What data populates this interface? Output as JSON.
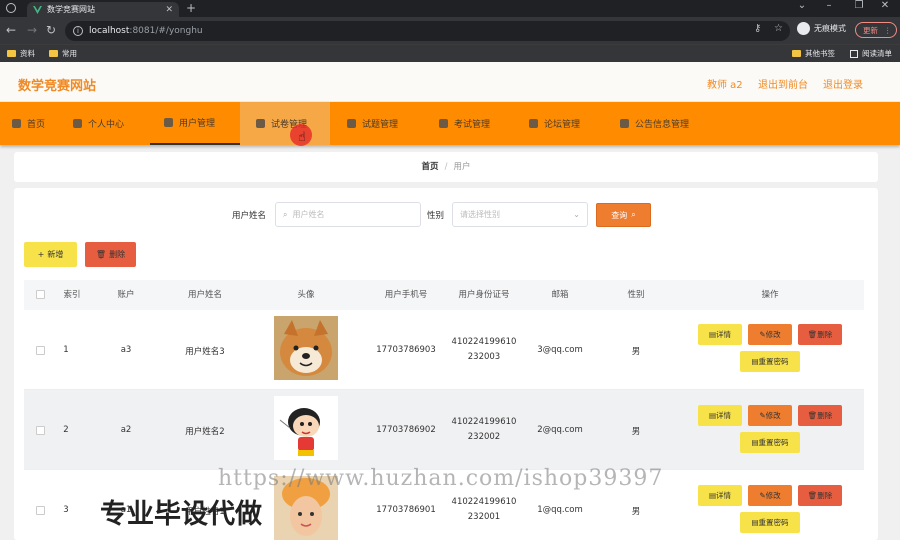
{
  "browser": {
    "tab_title": "数学竞赛网站",
    "url_host": "localhost",
    "url_path": ":8081/#/yonghu",
    "guest_label": "无痕模式",
    "update_label": "更新",
    "bookmarks": [
      "资料",
      "常用"
    ],
    "bookmarks_right": [
      "其他书签",
      "阅读清单"
    ]
  },
  "header": {
    "site_title": "数学竞赛网站",
    "user_label": "教师 a2",
    "backend_link": "退出到前台",
    "logout_link": "退出登录"
  },
  "nav": [
    {
      "label": "首页"
    },
    {
      "label": "个人中心"
    },
    {
      "label": "用户管理"
    },
    {
      "label": "试卷管理"
    },
    {
      "label": "试题管理"
    },
    {
      "label": "考试管理"
    },
    {
      "label": "论坛管理"
    },
    {
      "label": "公告信息管理"
    }
  ],
  "breadcrumb": {
    "home": "首页",
    "current": "用户"
  },
  "search": {
    "name_label": "用户姓名",
    "name_placeholder": "用户姓名",
    "gender_label": "性别",
    "gender_placeholder": "请选择性别",
    "query_button": "查询"
  },
  "actions": {
    "add": "新增",
    "delete": "删除"
  },
  "table": {
    "headers": [
      "索引",
      "账户",
      "用户姓名",
      "头像",
      "用户手机号",
      "用户身份证号",
      "邮箱",
      "性别",
      "操作"
    ],
    "row_buttons": {
      "detail": "详情",
      "edit": "修改",
      "delete": "删除",
      "reset": "重置密码"
    },
    "rows": [
      {
        "index": "1",
        "account": "a3",
        "name": "用户姓名3",
        "phone": "17703786903",
        "id1": "410224199610",
        "id2": "232003",
        "email": "3@qq.com",
        "gender": "男"
      },
      {
        "index": "2",
        "account": "a2",
        "name": "用户姓名2",
        "phone": "17703786902",
        "id1": "410224199610",
        "id2": "232002",
        "email": "2@qq.com",
        "gender": "男"
      },
      {
        "index": "3",
        "account": "a1",
        "name": "用户姓名1",
        "phone": "17703786901",
        "id1": "410224199610",
        "id2": "232001",
        "email": "1@qq.com",
        "gender": "男"
      }
    ]
  },
  "watermark": {
    "url": "https://www.huzhan.com/ishop39397",
    "caption": "专业毕设代做"
  },
  "colors": {
    "accent": "#f08a24",
    "nav_bg": "#ff8c00",
    "danger": "#e75d3f",
    "warn": "#f8e24a"
  }
}
